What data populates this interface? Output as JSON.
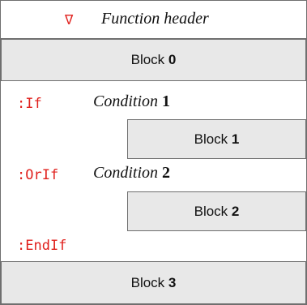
{
  "header": {
    "symbol": "∇",
    "title": "Function header"
  },
  "blocks": [
    {
      "word": "Block",
      "number": "0"
    },
    {
      "word": "Block",
      "number": "1"
    },
    {
      "word": "Block",
      "number": "2"
    },
    {
      "word": "Block",
      "number": "3"
    }
  ],
  "keywords": {
    "if": ":If",
    "orif": ":OrIf",
    "endif": ":EndIf"
  },
  "conditions": [
    {
      "word": "Condition",
      "number": "1"
    },
    {
      "word": "Condition",
      "number": "2"
    }
  ],
  "colors": {
    "keyword": "#e0201c",
    "block_fill": "#e8e8e8",
    "border": "#6f6f6f"
  }
}
